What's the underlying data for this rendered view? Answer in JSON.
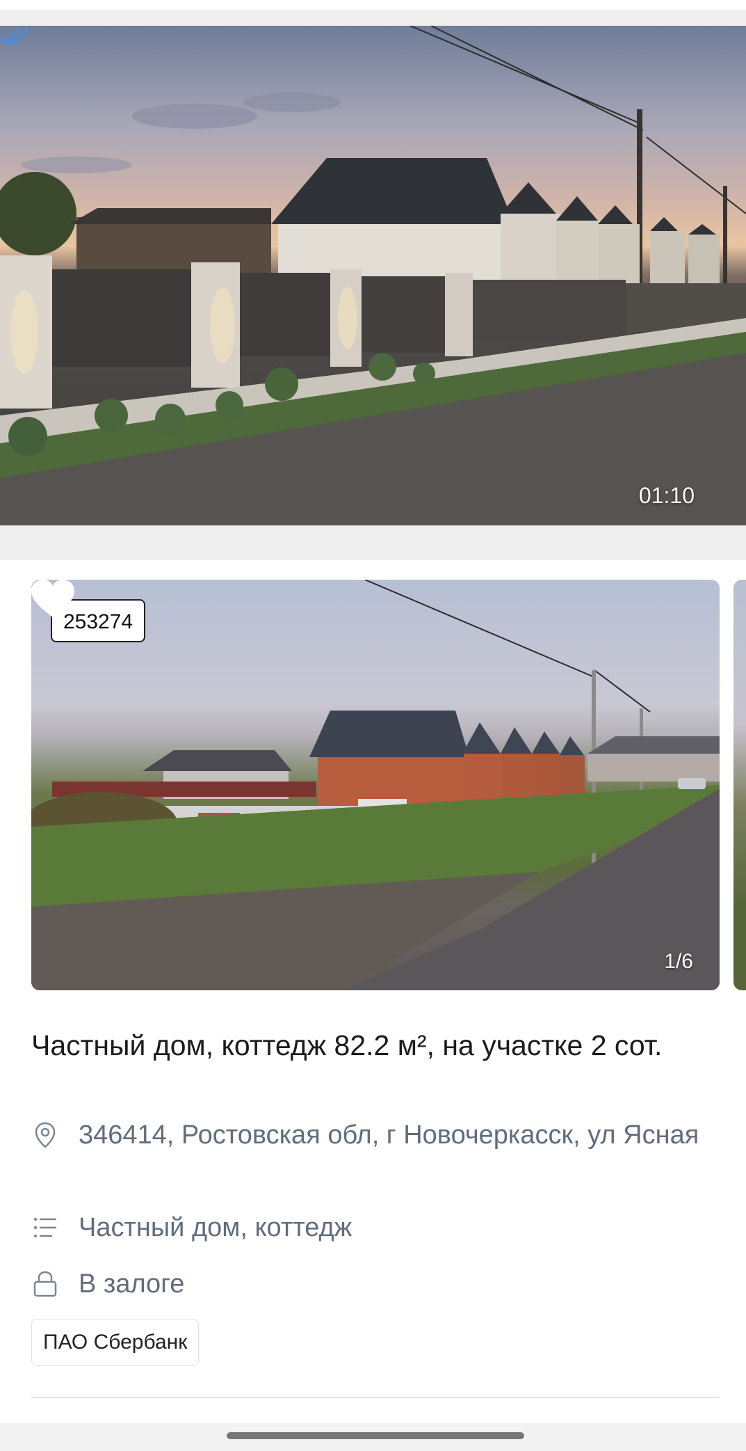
{
  "message": {
    "time": "01:10",
    "status_icon": "double-check-icon",
    "status_color": "#3d8ff5"
  },
  "listing": {
    "id": "253274",
    "favorite_icon": "heart-icon",
    "photo_counter": "1/6",
    "title": "Частный дом, коттедж 82.2 м², на участке 2 сот.",
    "address_icon": "location-pin-icon",
    "address": "346414, Ростовская обл, г Новочеркасск, ул Ясная",
    "type_icon": "list-icon",
    "type": "Частный дом, коттедж",
    "status_icon": "lock-icon",
    "status": "В залоге",
    "bank": "ПАО Сбербанк"
  },
  "colors": {
    "text_primary": "#1c1c1c",
    "text_secondary": "#616d7d",
    "background": "#f2f2f2"
  }
}
